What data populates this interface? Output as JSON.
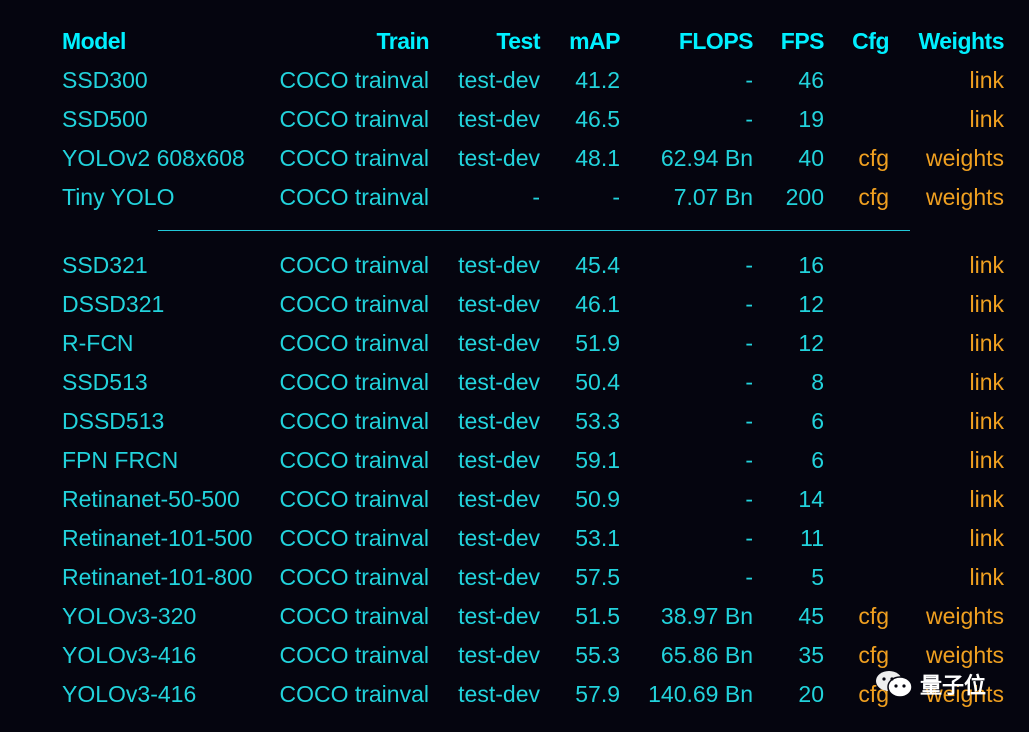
{
  "headers": [
    "Model",
    "Train",
    "Test",
    "mAP",
    "FLOPS",
    "FPS",
    "Cfg",
    "Weights"
  ],
  "groups": [
    [
      [
        "SSD300",
        "COCO trainval",
        "test-dev",
        "41.2",
        "-",
        "46",
        "",
        "link"
      ],
      [
        "SSD500",
        "COCO trainval",
        "test-dev",
        "46.5",
        "-",
        "19",
        "",
        "link"
      ],
      [
        "YOLOv2 608x608",
        "COCO trainval",
        "test-dev",
        "48.1",
        "62.94 Bn",
        "40",
        "cfg",
        "weights"
      ],
      [
        "Tiny YOLO",
        "COCO trainval",
        "-",
        "-",
        "7.07 Bn",
        "200",
        "cfg",
        "weights"
      ]
    ],
    [
      [
        "SSD321",
        "COCO trainval",
        "test-dev",
        "45.4",
        "-",
        "16",
        "",
        "link"
      ],
      [
        "DSSD321",
        "COCO trainval",
        "test-dev",
        "46.1",
        "-",
        "12",
        "",
        "link"
      ],
      [
        "R-FCN",
        "COCO trainval",
        "test-dev",
        "51.9",
        "-",
        "12",
        "",
        "link"
      ],
      [
        "SSD513",
        "COCO trainval",
        "test-dev",
        "50.4",
        "-",
        "8",
        "",
        "link"
      ],
      [
        "DSSD513",
        "COCO trainval",
        "test-dev",
        "53.3",
        "-",
        "6",
        "",
        "link"
      ],
      [
        "FPN FRCN",
        "COCO trainval",
        "test-dev",
        "59.1",
        "-",
        "6",
        "",
        "link"
      ],
      [
        "Retinanet-50-500",
        "COCO trainval",
        "test-dev",
        "50.9",
        "-",
        "14",
        "",
        "link"
      ],
      [
        "Retinanet-101-500",
        "COCO trainval",
        "test-dev",
        "53.1",
        "-",
        "11",
        "",
        "link"
      ],
      [
        "Retinanet-101-800",
        "COCO trainval",
        "test-dev",
        "57.5",
        "-",
        "5",
        "",
        "link"
      ],
      [
        "YOLOv3-320",
        "COCO trainval",
        "test-dev",
        "51.5",
        "38.97 Bn",
        "45",
        "cfg",
        "weights"
      ],
      [
        "YOLOv3-416",
        "COCO trainval",
        "test-dev",
        "55.3",
        "65.86 Bn",
        "35",
        "cfg",
        "weights"
      ],
      [
        "YOLOv3-416",
        "COCO trainval",
        "test-dev",
        "57.9",
        "140.69 Bn",
        "20",
        "cfg",
        "weights"
      ]
    ]
  ],
  "watermark": "量子位",
  "colors": {
    "text": "#22d3dc",
    "header": "#00f0ff",
    "link": "#f0a020",
    "background": "#05050f"
  }
}
